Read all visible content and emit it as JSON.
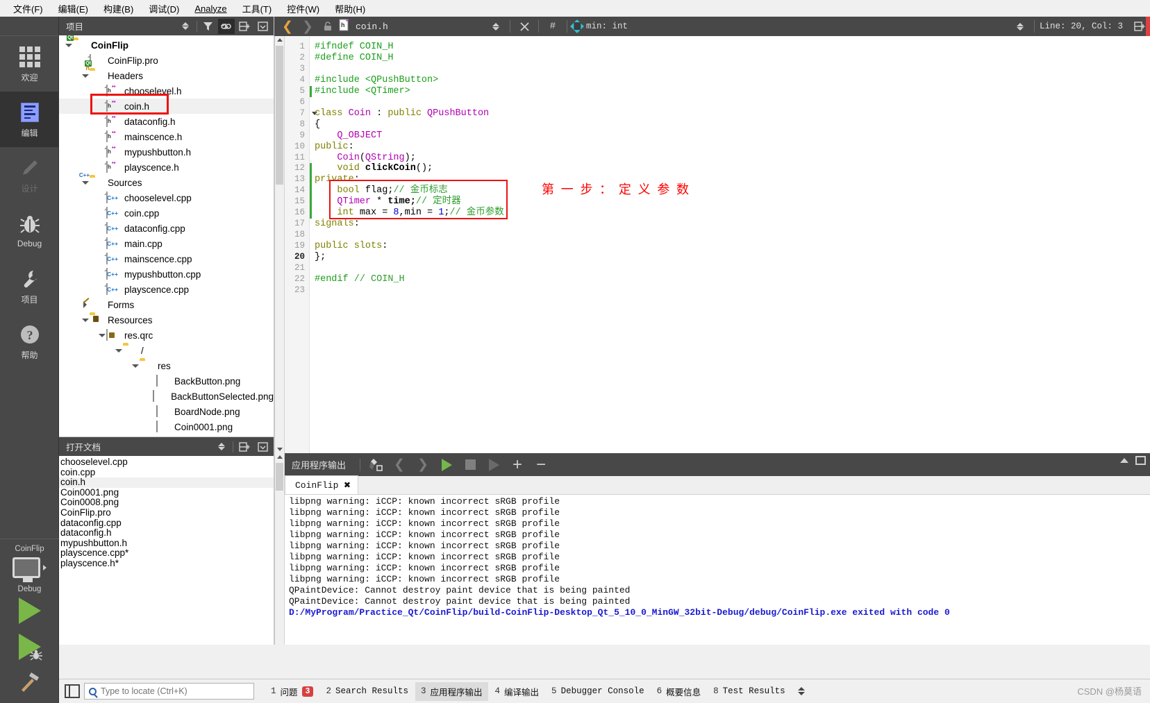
{
  "menubar": [
    {
      "label": "文件(F)"
    },
    {
      "label": "编辑(E)"
    },
    {
      "label": "构建(B)"
    },
    {
      "label": "调试(D)"
    },
    {
      "label": "Analyze"
    },
    {
      "label": "工具(T)"
    },
    {
      "label": "控件(W)"
    },
    {
      "label": "帮助(H)"
    }
  ],
  "modebar": {
    "items": [
      {
        "label": "欢迎",
        "icon": "grid-icon",
        "state": "normal"
      },
      {
        "label": "编辑",
        "icon": "edit-icon",
        "state": "active"
      },
      {
        "label": "设计",
        "icon": "pencil-icon",
        "state": "disabled"
      },
      {
        "label": "Debug",
        "icon": "bug-icon",
        "state": "normal"
      },
      {
        "label": "项目",
        "icon": "wrench-icon",
        "state": "normal"
      },
      {
        "label": "帮助",
        "icon": "question-icon",
        "state": "normal"
      }
    ],
    "kit": {
      "project_name": "CoinFlip",
      "build_config": "Debug",
      "run_label": "运行",
      "debug_label": "调试",
      "build_label": "构建"
    }
  },
  "project_panel": {
    "title": "项目",
    "tree": [
      {
        "depth": 0,
        "label": "CoinFlip",
        "icon": "qt-folder-icon",
        "arrow": "down",
        "bold": true
      },
      {
        "depth": 1,
        "label": "CoinFlip.pro",
        "icon": "qt-pro-icon",
        "arrow": "none"
      },
      {
        "depth": 1,
        "label": "Headers",
        "icon": "folder-h-icon",
        "arrow": "down"
      },
      {
        "depth": 2,
        "label": "chooselevel.h",
        "icon": "header-file-icon",
        "arrow": "none"
      },
      {
        "depth": 2,
        "label": "coin.h",
        "icon": "header-file-icon",
        "arrow": "none",
        "selected": true
      },
      {
        "depth": 2,
        "label": "dataconfig.h",
        "icon": "header-file-icon",
        "arrow": "none"
      },
      {
        "depth": 2,
        "label": "mainscence.h",
        "icon": "header-file-icon",
        "arrow": "none"
      },
      {
        "depth": 2,
        "label": "mypushbutton.h",
        "icon": "header-file-icon",
        "arrow": "none"
      },
      {
        "depth": 2,
        "label": "playscence.h",
        "icon": "header-file-icon",
        "arrow": "none"
      },
      {
        "depth": 1,
        "label": "Sources",
        "icon": "folder-cpp-icon",
        "arrow": "down"
      },
      {
        "depth": 2,
        "label": "chooselevel.cpp",
        "icon": "cpp-file-icon",
        "arrow": "none"
      },
      {
        "depth": 2,
        "label": "coin.cpp",
        "icon": "cpp-file-icon",
        "arrow": "none"
      },
      {
        "depth": 2,
        "label": "dataconfig.cpp",
        "icon": "cpp-file-icon",
        "arrow": "none"
      },
      {
        "depth": 2,
        "label": "main.cpp",
        "icon": "cpp-file-icon",
        "arrow": "none"
      },
      {
        "depth": 2,
        "label": "mainscence.cpp",
        "icon": "cpp-file-icon",
        "arrow": "none"
      },
      {
        "depth": 2,
        "label": "mypushbutton.cpp",
        "icon": "cpp-file-icon",
        "arrow": "none"
      },
      {
        "depth": 2,
        "label": "playscence.cpp",
        "icon": "cpp-file-icon",
        "arrow": "none"
      },
      {
        "depth": 1,
        "label": "Forms",
        "icon": "forms-folder-icon",
        "arrow": "right"
      },
      {
        "depth": 1,
        "label": "Resources",
        "icon": "resources-folder-icon",
        "arrow": "down"
      },
      {
        "depth": 2,
        "label": "res.qrc",
        "icon": "qrc-file-icon",
        "arrow": "down"
      },
      {
        "depth": 3,
        "label": "/",
        "icon": "folder-icon",
        "arrow": "down"
      },
      {
        "depth": 4,
        "label": "res",
        "icon": "folder-icon",
        "arrow": "down"
      },
      {
        "depth": 5,
        "label": "BackButton.png",
        "icon": "image-file-icon",
        "arrow": "none"
      },
      {
        "depth": 5,
        "label": "BackButtonSelected.png",
        "icon": "image-file-icon",
        "arrow": "none"
      },
      {
        "depth": 5,
        "label": "BoardNode.png",
        "icon": "image-file-icon",
        "arrow": "none"
      },
      {
        "depth": 5,
        "label": "Coin0001.png",
        "icon": "image-file-icon",
        "arrow": "none"
      }
    ],
    "highlight_color": "#ee1111"
  },
  "open_documents": {
    "title": "打开文档",
    "files": [
      {
        "label": "chooselevel.cpp"
      },
      {
        "label": "coin.cpp"
      },
      {
        "label": "coin.h",
        "selected": true
      },
      {
        "label": "Coin0001.png"
      },
      {
        "label": "Coin0008.png"
      },
      {
        "label": "CoinFlip.pro"
      },
      {
        "label": "dataconfig.cpp"
      },
      {
        "label": "dataconfig.h"
      },
      {
        "label": "mypushbutton.h"
      },
      {
        "label": "playscence.cpp*"
      },
      {
        "label": "playscence.h*"
      }
    ]
  },
  "editor_toolbar": {
    "file_name": "coin.h",
    "symbol": "min: int",
    "line_col": "Line: 20, Col: 3",
    "hash_label": "#"
  },
  "editor": {
    "current_line": 20,
    "annotation": "第 一 步 ：  定 义 参 数",
    "annotation_color": "#ff0000",
    "lines": [
      {
        "n": 1,
        "tokens": [
          {
            "t": "#ifndef COIN_H",
            "c": "k-pre"
          }
        ]
      },
      {
        "n": 2,
        "tokens": [
          {
            "t": "#define COIN_H",
            "c": "k-pre"
          }
        ]
      },
      {
        "n": 3,
        "tokens": []
      },
      {
        "n": 4,
        "tokens": [
          {
            "t": "#include <QPushButton>",
            "c": "k-pre"
          }
        ]
      },
      {
        "n": 5,
        "tokens": [
          {
            "t": "#include <QTimer>",
            "c": "k-pre"
          }
        ],
        "changed": true
      },
      {
        "n": 6,
        "tokens": []
      },
      {
        "n": 7,
        "tokens": [
          {
            "t": "class ",
            "c": "k-kw"
          },
          {
            "t": "Coin ",
            "c": "k-type"
          },
          {
            "t": ": ",
            "c": "k-plain"
          },
          {
            "t": "public ",
            "c": "k-kw"
          },
          {
            "t": "QPushButton",
            "c": "k-type"
          }
        ],
        "fold": true
      },
      {
        "n": 8,
        "tokens": [
          {
            "t": "{",
            "c": "k-plain"
          }
        ]
      },
      {
        "n": 9,
        "tokens": [
          {
            "t": "    Q_OBJECT",
            "c": "k-type"
          }
        ]
      },
      {
        "n": 10,
        "tokens": [
          {
            "t": "public",
            "c": "k-kw"
          },
          {
            "t": ":",
            "c": "k-plain"
          }
        ]
      },
      {
        "n": 11,
        "tokens": [
          {
            "t": "    Coin",
            "c": "k-type"
          },
          {
            "t": "(",
            "c": "k-plain"
          },
          {
            "t": "QString",
            "c": "k-type"
          },
          {
            "t": ");",
            "c": "k-plain"
          }
        ]
      },
      {
        "n": 12,
        "tokens": [
          {
            "t": "    void ",
            "c": "k-kw"
          },
          {
            "t": "clickCoin",
            "c": "k-fn"
          },
          {
            "t": "();",
            "c": "k-plain"
          }
        ],
        "changed": true
      },
      {
        "n": 13,
        "tokens": [
          {
            "t": "private",
            "c": "k-kw"
          },
          {
            "t": ":",
            "c": "k-plain"
          }
        ],
        "changed": true
      },
      {
        "n": 14,
        "tokens": [
          {
            "t": "    bool ",
            "c": "k-kw"
          },
          {
            "t": "flag;",
            "c": "k-plain"
          },
          {
            "t": "// 金币标志",
            "c": "k-cmt"
          }
        ],
        "changed": true
      },
      {
        "n": 15,
        "tokens": [
          {
            "t": "    QTimer ",
            "c": "k-type"
          },
          {
            "t": "* ",
            "c": "k-plain"
          },
          {
            "t": "time;",
            "c": "k-fn"
          },
          {
            "t": "// 定时器",
            "c": "k-cmt"
          }
        ],
        "changed": true
      },
      {
        "n": 16,
        "tokens": [
          {
            "t": "    int ",
            "c": "k-kw"
          },
          {
            "t": "max = ",
            "c": "k-plain"
          },
          {
            "t": "8",
            "c": "k-num"
          },
          {
            "t": ",min = ",
            "c": "k-plain"
          },
          {
            "t": "1",
            "c": "k-num"
          },
          {
            "t": ";",
            "c": "k-plain"
          },
          {
            "t": "// 金币参数",
            "c": "k-cmt"
          }
        ],
        "changed": true
      },
      {
        "n": 17,
        "tokens": [
          {
            "t": "signals",
            "c": "k-kw"
          },
          {
            "t": ":",
            "c": "k-plain"
          }
        ]
      },
      {
        "n": 18,
        "tokens": []
      },
      {
        "n": 19,
        "tokens": [
          {
            "t": "public slots",
            "c": "k-kw"
          },
          {
            "t": ":",
            "c": "k-plain"
          }
        ]
      },
      {
        "n": 20,
        "tokens": [
          {
            "t": "};",
            "c": "k-plain"
          }
        ],
        "current": true
      },
      {
        "n": 21,
        "tokens": []
      },
      {
        "n": 22,
        "tokens": [
          {
            "t": "#endif ",
            "c": "k-pre"
          },
          {
            "t": "// COIN_H",
            "c": "k-cmt"
          }
        ]
      },
      {
        "n": 23,
        "tokens": []
      }
    ]
  },
  "output_pane": {
    "title": "应用程序输出",
    "tab_label": "CoinFlip",
    "lines": [
      {
        "text": "libpng warning: iCCP: known incorrect sRGB profile"
      },
      {
        "text": "libpng warning: iCCP: known incorrect sRGB profile"
      },
      {
        "text": "libpng warning: iCCP: known incorrect sRGB profile"
      },
      {
        "text": "libpng warning: iCCP: known incorrect sRGB profile"
      },
      {
        "text": "libpng warning: iCCP: known incorrect sRGB profile"
      },
      {
        "text": "libpng warning: iCCP: known incorrect sRGB profile"
      },
      {
        "text": "libpng warning: iCCP: known incorrect sRGB profile"
      },
      {
        "text": "libpng warning: iCCP: known incorrect sRGB profile"
      },
      {
        "text": "QPaintDevice: Cannot destroy paint device that is being painted"
      },
      {
        "text": "QPaintDevice: Cannot destroy paint device that is being painted"
      },
      {
        "text": "D:/MyProgram/Practice_Qt/CoinFlip/build-CoinFlip-Desktop_Qt_5_10_0_MinGW_32bit-Debug/debug/CoinFlip.exe exited with code 0",
        "link": true
      }
    ],
    "link_color": "#1a1ad0"
  },
  "statusbar": {
    "locator_placeholder": "Type to locate (Ctrl+K)",
    "tabs": [
      {
        "num": "1",
        "label": "问题",
        "badge": "3"
      },
      {
        "num": "2",
        "label": "Search Results"
      },
      {
        "num": "3",
        "label": "应用程序输出",
        "active": true
      },
      {
        "num": "4",
        "label": "编译输出"
      },
      {
        "num": "5",
        "label": "Debugger Console"
      },
      {
        "num": "6",
        "label": "概要信息"
      },
      {
        "num": "8",
        "label": "Test Results"
      }
    ],
    "watermark": "CSDN @杨莫语"
  }
}
